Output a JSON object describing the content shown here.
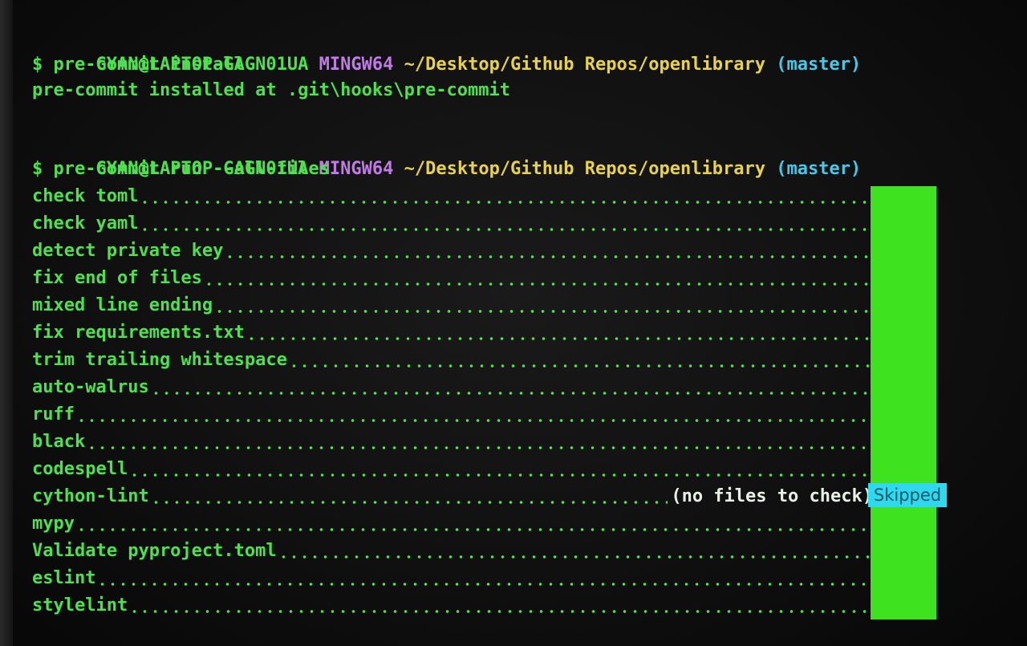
{
  "prompt1": {
    "user": "GYAN@LAPTOP-GAGN01UA",
    "system": "MINGW64",
    "path": "~/Desktop/Github Repos/openlibrary",
    "branch": "(master)"
  },
  "command1": "$ pre-commit install",
  "output1": "pre-commit installed at .git\\hooks\\pre-commit",
  "prompt2": {
    "user": "GYAN@LAPTOP-GAGN01UA",
    "system": "MINGW64",
    "path": "~/Desktop/Github Repos/openlibrary",
    "branch": "(master)"
  },
  "command2": "$ pre-commit run --all-files",
  "hooks": [
    {
      "name": "check toml",
      "note": ""
    },
    {
      "name": "check yaml",
      "note": ""
    },
    {
      "name": "detect private key",
      "note": ""
    },
    {
      "name": "fix end of files",
      "note": ""
    },
    {
      "name": "mixed line ending",
      "note": ""
    },
    {
      "name": "fix requirements.txt",
      "note": ""
    },
    {
      "name": "trim trailing whitespace",
      "note": ""
    },
    {
      "name": "auto-walrus",
      "note": ""
    },
    {
      "name": "ruff",
      "note": ""
    },
    {
      "name": "black",
      "note": ""
    },
    {
      "name": "codespell",
      "note": ""
    },
    {
      "name": "cython-lint",
      "note": "(no files to check)"
    },
    {
      "name": "mypy",
      "note": ""
    },
    {
      "name": "Validate pyproject.toml",
      "note": ""
    },
    {
      "name": "eslint",
      "note": ""
    },
    {
      "name": "stylelint",
      "note": ""
    }
  ],
  "skipped_label": "Skipped",
  "colors": {
    "user": "#4ee04e",
    "system": "#c27ae8",
    "path": "#e8d24a",
    "branch": "#47c8e8",
    "passed_bar": "#3fe21e",
    "skipped_bg": "#2ed8ef"
  }
}
